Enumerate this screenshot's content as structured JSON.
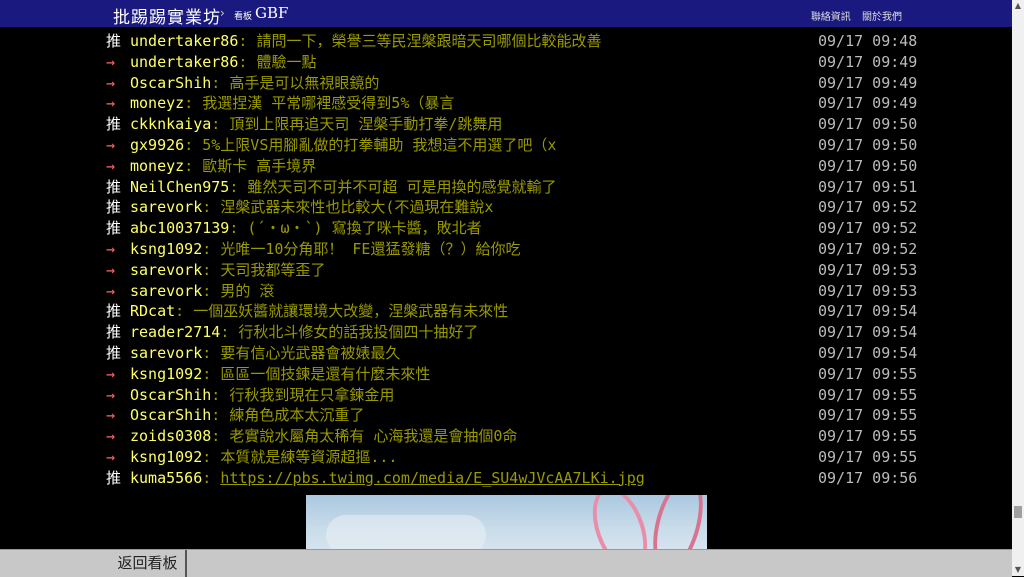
{
  "header": {
    "brand": "批踢踢實業坊",
    "separator": "›",
    "board_label": "看板",
    "board_name": "GBF",
    "links": [
      "聯絡資訊",
      "關於我們"
    ]
  },
  "comments": [
    {
      "tag": "推",
      "type": "push",
      "user": "undertaker86",
      "text": "請問一下，榮譽三等民涅槃跟暗天司哪個比較能改善",
      "time": "09/17 09:48"
    },
    {
      "tag": "→",
      "type": "arrow",
      "user": "undertaker86",
      "text": "體驗一點",
      "time": "09/17 09:49"
    },
    {
      "tag": "→",
      "type": "arrow",
      "user": "OscarShih",
      "text": "高手是可以無視眼鏡的",
      "time": "09/17 09:49"
    },
    {
      "tag": "→",
      "type": "arrow",
      "user": "moneyz",
      "text": "我選捏漢 平常哪裡感受得到5%（暴言",
      "time": "09/17 09:49"
    },
    {
      "tag": "推",
      "type": "push",
      "user": "ckknkaiya",
      "text": "頂到上限再追天司 涅槃手動打拳/跳舞用",
      "time": "09/17 09:50"
    },
    {
      "tag": "→",
      "type": "arrow",
      "user": "gx9926",
      "text": "5%上限VS用腳亂做的打拳輔助 我想這不用選了吧（x",
      "time": "09/17 09:50"
    },
    {
      "tag": "→",
      "type": "arrow",
      "user": "moneyz",
      "text": "歐斯卡 高手境界",
      "time": "09/17 09:50"
    },
    {
      "tag": "推",
      "type": "push",
      "user": "NeilChen975",
      "text": "雖然天司不可并不可超 可是用換的感覺就輸了",
      "time": "09/17 09:51"
    },
    {
      "tag": "推",
      "type": "push",
      "user": "sarevork",
      "text": "涅槃武器未來性也比較大(不過現在難說x",
      "time": "09/17 09:52"
    },
    {
      "tag": "推",
      "type": "push",
      "user": "abc10037139",
      "text": "(´・ω・`) 寫換了咪卡醬，敗北者",
      "time": "09/17 09:52"
    },
    {
      "tag": "→",
      "type": "arrow",
      "user": "ksng1092",
      "text": "光唯一10分角耶！ FE還猛發糖（？）給你吃",
      "time": "09/17 09:52"
    },
    {
      "tag": "→",
      "type": "arrow",
      "user": "sarevork",
      "text": "天司我都等歪了",
      "time": "09/17 09:53"
    },
    {
      "tag": "→",
      "type": "arrow",
      "user": "sarevork",
      "text": "男的 滾",
      "time": "09/17 09:53"
    },
    {
      "tag": "推",
      "type": "push",
      "user": "RDcat",
      "text": "一個巫妖醬就讓環境大改變，涅槃武器有未來性",
      "time": "09/17 09:54"
    },
    {
      "tag": "推",
      "type": "push",
      "user": "reader2714",
      "text": "行秋北斗修女的話我投個四十抽好了",
      "time": "09/17 09:54"
    },
    {
      "tag": "推",
      "type": "push",
      "user": "sarevork",
      "text": "要有信心光武器會被婊最久",
      "time": "09/17 09:54"
    },
    {
      "tag": "→",
      "type": "arrow",
      "user": "ksng1092",
      "text": "區區一個技鍊是還有什麼未來性",
      "time": "09/17 09:55"
    },
    {
      "tag": "→",
      "type": "arrow",
      "user": "OscarShih",
      "text": "行秋我到現在只拿鍊金用",
      "time": "09/17 09:55"
    },
    {
      "tag": "→",
      "type": "arrow",
      "user": "OscarShih",
      "text": "練角色成本太沉重了",
      "time": "09/17 09:55"
    },
    {
      "tag": "→",
      "type": "arrow",
      "user": "zoids0308",
      "text": "老實說水屬角太稀有 心海我還是會抽個0命",
      "time": "09/17 09:55"
    },
    {
      "tag": "→",
      "type": "arrow",
      "user": "ksng1092",
      "text": "本質就是練等資源超摳...",
      "time": "09/17 09:55"
    },
    {
      "tag": "推",
      "type": "push",
      "user": "kuma5566",
      "text": "https://pbs.twimg.com/media/E_SU4wJVcAA7LKi.jpg",
      "time": "09/17 09:56",
      "is_link": true
    }
  ],
  "footer": {
    "back_label": "返回看板"
  },
  "scrollbar": {
    "up": "▲",
    "down": "▼"
  }
}
